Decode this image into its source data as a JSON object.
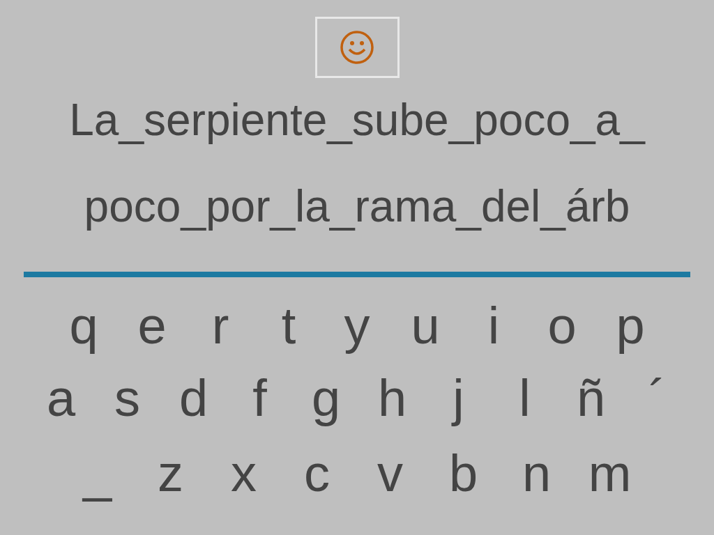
{
  "feedback": {
    "kind": "happy"
  },
  "phrase_lines": [
    "La_serpiente_sube_poco_a_",
    "poco_por_la_rama_del_árb"
  ],
  "keyboard_rows": [
    [
      "q",
      "e",
      "r",
      "t",
      "y",
      "u",
      "i",
      "o",
      "p"
    ],
    [
      "a",
      "s",
      "d",
      "f",
      "g",
      "h",
      "j",
      "l",
      "ñ",
      "´"
    ],
    [
      "_",
      "z",
      "x",
      "c",
      "v",
      "b",
      "n",
      "m"
    ]
  ]
}
